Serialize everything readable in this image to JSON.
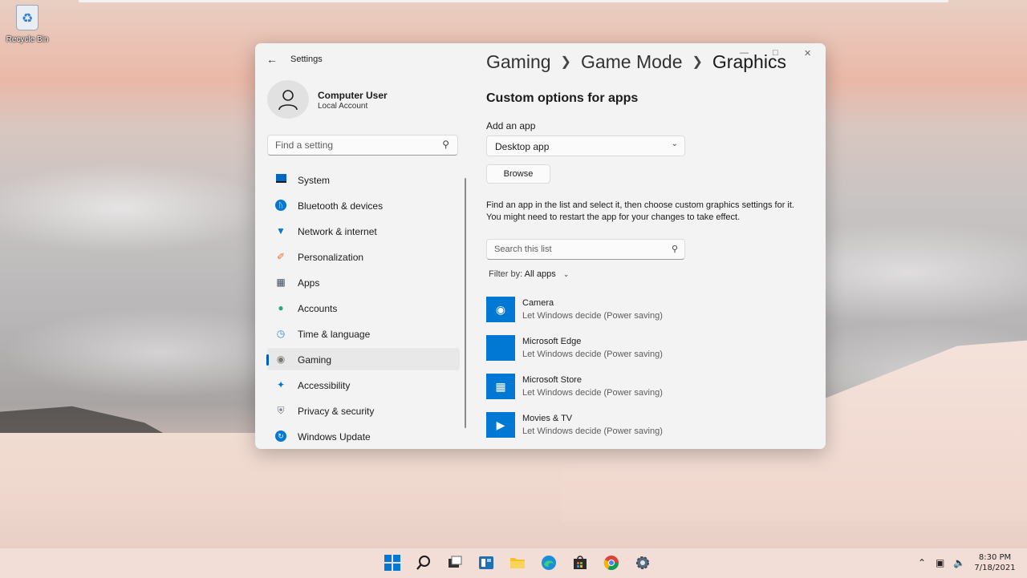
{
  "desktop": {
    "recycle_bin_label": "Recycle Bin"
  },
  "window": {
    "app_title": "Settings",
    "back_icon": "arrow-left-icon",
    "user": {
      "name": "Computer User",
      "account_type": "Local Account"
    },
    "search": {
      "placeholder": "Find a setting"
    },
    "nav": [
      {
        "label": "System",
        "icon": "monitor-icon",
        "active": false
      },
      {
        "label": "Bluetooth & devices",
        "icon": "bluetooth-icon",
        "active": false
      },
      {
        "label": "Network & internet",
        "icon": "wifi-icon",
        "active": false
      },
      {
        "label": "Personalization",
        "icon": "brush-icon",
        "active": false
      },
      {
        "label": "Apps",
        "icon": "apps-icon",
        "active": false
      },
      {
        "label": "Accounts",
        "icon": "person-icon",
        "active": false
      },
      {
        "label": "Time & language",
        "icon": "globe-clock-icon",
        "active": false
      },
      {
        "label": "Gaming",
        "icon": "gamepad-icon",
        "active": true
      },
      {
        "label": "Accessibility",
        "icon": "accessibility-icon",
        "active": false
      },
      {
        "label": "Privacy & security",
        "icon": "shield-icon",
        "active": false
      },
      {
        "label": "Windows Update",
        "icon": "update-icon",
        "active": false
      }
    ],
    "breadcrumb": [
      "Gaming",
      "Game Mode",
      "Graphics"
    ],
    "main": {
      "heading": "Custom options for apps",
      "add_app_label": "Add an app",
      "add_app_value": "Desktop app",
      "browse_label": "Browse",
      "description": "Find an app in the list and select it, then choose custom graphics settings for it. You might need to restart the app for your changes to take effect.",
      "list_search_placeholder": "Search this list",
      "filter_label": "Filter by:",
      "filter_value": "All apps",
      "apps": [
        {
          "name": "Camera",
          "setting": "Let Windows decide (Power saving)",
          "icon": "camera-icon"
        },
        {
          "name": "Microsoft Edge",
          "setting": "Let Windows decide (Power saving)",
          "icon": "edge-icon"
        },
        {
          "name": "Microsoft Store",
          "setting": "Let Windows decide (Power saving)",
          "icon": "store-icon"
        },
        {
          "name": "Movies & TV",
          "setting": "Let Windows decide (Power saving)",
          "icon": "movies-icon"
        }
      ]
    }
  },
  "taskbar": {
    "icons": [
      "start-icon",
      "search-icon",
      "task-view-icon",
      "widgets-icon",
      "file-explorer-icon",
      "edge-icon",
      "store-icon",
      "chrome-icon",
      "settings-icon"
    ],
    "time": "8:30 PM",
    "date": "7/18/2021"
  },
  "colors": {
    "accent": "#005fb8",
    "app_tile": "#0078d4"
  }
}
